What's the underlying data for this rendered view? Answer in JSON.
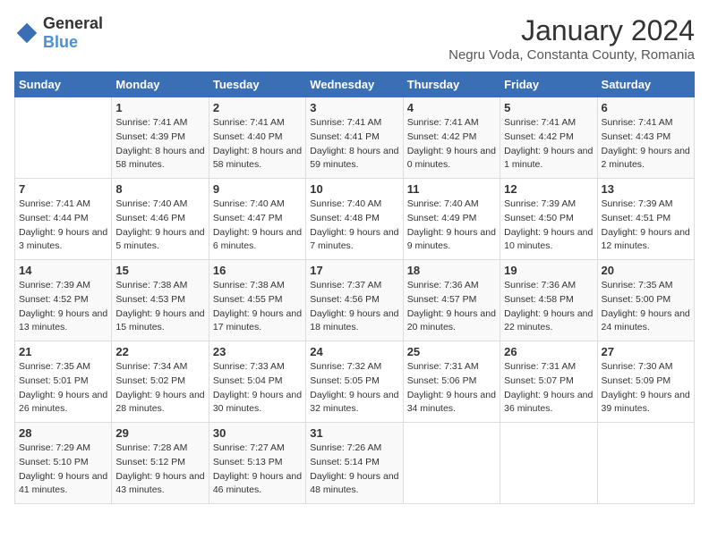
{
  "header": {
    "logo_general": "General",
    "logo_blue": "Blue",
    "title": "January 2024",
    "subtitle": "Negru Voda, Constanta County, Romania"
  },
  "days_of_week": [
    "Sunday",
    "Monday",
    "Tuesday",
    "Wednesday",
    "Thursday",
    "Friday",
    "Saturday"
  ],
  "weeks": [
    [
      {
        "day": "",
        "sunrise": "",
        "sunset": "",
        "daylight": ""
      },
      {
        "day": "1",
        "sunrise": "Sunrise: 7:41 AM",
        "sunset": "Sunset: 4:39 PM",
        "daylight": "Daylight: 8 hours and 58 minutes."
      },
      {
        "day": "2",
        "sunrise": "Sunrise: 7:41 AM",
        "sunset": "Sunset: 4:40 PM",
        "daylight": "Daylight: 8 hours and 58 minutes."
      },
      {
        "day": "3",
        "sunrise": "Sunrise: 7:41 AM",
        "sunset": "Sunset: 4:41 PM",
        "daylight": "Daylight: 8 hours and 59 minutes."
      },
      {
        "day": "4",
        "sunrise": "Sunrise: 7:41 AM",
        "sunset": "Sunset: 4:42 PM",
        "daylight": "Daylight: 9 hours and 0 minutes."
      },
      {
        "day": "5",
        "sunrise": "Sunrise: 7:41 AM",
        "sunset": "Sunset: 4:42 PM",
        "daylight": "Daylight: 9 hours and 1 minute."
      },
      {
        "day": "6",
        "sunrise": "Sunrise: 7:41 AM",
        "sunset": "Sunset: 4:43 PM",
        "daylight": "Daylight: 9 hours and 2 minutes."
      }
    ],
    [
      {
        "day": "7",
        "sunrise": "Sunrise: 7:41 AM",
        "sunset": "Sunset: 4:44 PM",
        "daylight": "Daylight: 9 hours and 3 minutes."
      },
      {
        "day": "8",
        "sunrise": "Sunrise: 7:40 AM",
        "sunset": "Sunset: 4:46 PM",
        "daylight": "Daylight: 9 hours and 5 minutes."
      },
      {
        "day": "9",
        "sunrise": "Sunrise: 7:40 AM",
        "sunset": "Sunset: 4:47 PM",
        "daylight": "Daylight: 9 hours and 6 minutes."
      },
      {
        "day": "10",
        "sunrise": "Sunrise: 7:40 AM",
        "sunset": "Sunset: 4:48 PM",
        "daylight": "Daylight: 9 hours and 7 minutes."
      },
      {
        "day": "11",
        "sunrise": "Sunrise: 7:40 AM",
        "sunset": "Sunset: 4:49 PM",
        "daylight": "Daylight: 9 hours and 9 minutes."
      },
      {
        "day": "12",
        "sunrise": "Sunrise: 7:39 AM",
        "sunset": "Sunset: 4:50 PM",
        "daylight": "Daylight: 9 hours and 10 minutes."
      },
      {
        "day": "13",
        "sunrise": "Sunrise: 7:39 AM",
        "sunset": "Sunset: 4:51 PM",
        "daylight": "Daylight: 9 hours and 12 minutes."
      }
    ],
    [
      {
        "day": "14",
        "sunrise": "Sunrise: 7:39 AM",
        "sunset": "Sunset: 4:52 PM",
        "daylight": "Daylight: 9 hours and 13 minutes."
      },
      {
        "day": "15",
        "sunrise": "Sunrise: 7:38 AM",
        "sunset": "Sunset: 4:53 PM",
        "daylight": "Daylight: 9 hours and 15 minutes."
      },
      {
        "day": "16",
        "sunrise": "Sunrise: 7:38 AM",
        "sunset": "Sunset: 4:55 PM",
        "daylight": "Daylight: 9 hours and 17 minutes."
      },
      {
        "day": "17",
        "sunrise": "Sunrise: 7:37 AM",
        "sunset": "Sunset: 4:56 PM",
        "daylight": "Daylight: 9 hours and 18 minutes."
      },
      {
        "day": "18",
        "sunrise": "Sunrise: 7:36 AM",
        "sunset": "Sunset: 4:57 PM",
        "daylight": "Daylight: 9 hours and 20 minutes."
      },
      {
        "day": "19",
        "sunrise": "Sunrise: 7:36 AM",
        "sunset": "Sunset: 4:58 PM",
        "daylight": "Daylight: 9 hours and 22 minutes."
      },
      {
        "day": "20",
        "sunrise": "Sunrise: 7:35 AM",
        "sunset": "Sunset: 5:00 PM",
        "daylight": "Daylight: 9 hours and 24 minutes."
      }
    ],
    [
      {
        "day": "21",
        "sunrise": "Sunrise: 7:35 AM",
        "sunset": "Sunset: 5:01 PM",
        "daylight": "Daylight: 9 hours and 26 minutes."
      },
      {
        "day": "22",
        "sunrise": "Sunrise: 7:34 AM",
        "sunset": "Sunset: 5:02 PM",
        "daylight": "Daylight: 9 hours and 28 minutes."
      },
      {
        "day": "23",
        "sunrise": "Sunrise: 7:33 AM",
        "sunset": "Sunset: 5:04 PM",
        "daylight": "Daylight: 9 hours and 30 minutes."
      },
      {
        "day": "24",
        "sunrise": "Sunrise: 7:32 AM",
        "sunset": "Sunset: 5:05 PM",
        "daylight": "Daylight: 9 hours and 32 minutes."
      },
      {
        "day": "25",
        "sunrise": "Sunrise: 7:31 AM",
        "sunset": "Sunset: 5:06 PM",
        "daylight": "Daylight: 9 hours and 34 minutes."
      },
      {
        "day": "26",
        "sunrise": "Sunrise: 7:31 AM",
        "sunset": "Sunset: 5:07 PM",
        "daylight": "Daylight: 9 hours and 36 minutes."
      },
      {
        "day": "27",
        "sunrise": "Sunrise: 7:30 AM",
        "sunset": "Sunset: 5:09 PM",
        "daylight": "Daylight: 9 hours and 39 minutes."
      }
    ],
    [
      {
        "day": "28",
        "sunrise": "Sunrise: 7:29 AM",
        "sunset": "Sunset: 5:10 PM",
        "daylight": "Daylight: 9 hours and 41 minutes."
      },
      {
        "day": "29",
        "sunrise": "Sunrise: 7:28 AM",
        "sunset": "Sunset: 5:12 PM",
        "daylight": "Daylight: 9 hours and 43 minutes."
      },
      {
        "day": "30",
        "sunrise": "Sunrise: 7:27 AM",
        "sunset": "Sunset: 5:13 PM",
        "daylight": "Daylight: 9 hours and 46 minutes."
      },
      {
        "day": "31",
        "sunrise": "Sunrise: 7:26 AM",
        "sunset": "Sunset: 5:14 PM",
        "daylight": "Daylight: 9 hours and 48 minutes."
      },
      {
        "day": "",
        "sunrise": "",
        "sunset": "",
        "daylight": ""
      },
      {
        "day": "",
        "sunrise": "",
        "sunset": "",
        "daylight": ""
      },
      {
        "day": "",
        "sunrise": "",
        "sunset": "",
        "daylight": ""
      }
    ]
  ]
}
